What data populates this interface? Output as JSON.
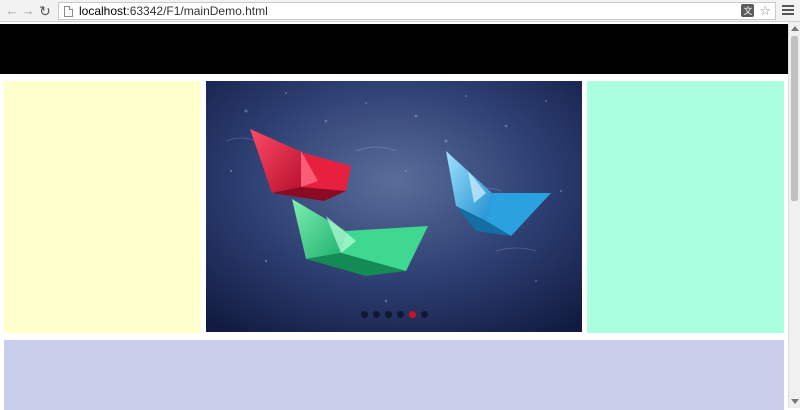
{
  "browser": {
    "url_host": "localhost",
    "url_path": ":63342/F1/mainDemo.html",
    "icons": {
      "back": "arrow-left-icon",
      "forward": "arrow-right-icon",
      "reload": "reload-icon",
      "page": "page-icon",
      "translate": "translate-icon",
      "bookmark": "star-icon",
      "menu": "hamburger-menu-icon"
    }
  },
  "page": {
    "colors": {
      "header": "#000000",
      "left_panel": "#ffffcc",
      "right_panel": "#aaffde",
      "footer_panel": "#c8cdea",
      "active_dot": "#d01020"
    },
    "slider": {
      "image": "paper-boats-in-rain",
      "dot_count": 6,
      "active_dot": 4
    }
  }
}
